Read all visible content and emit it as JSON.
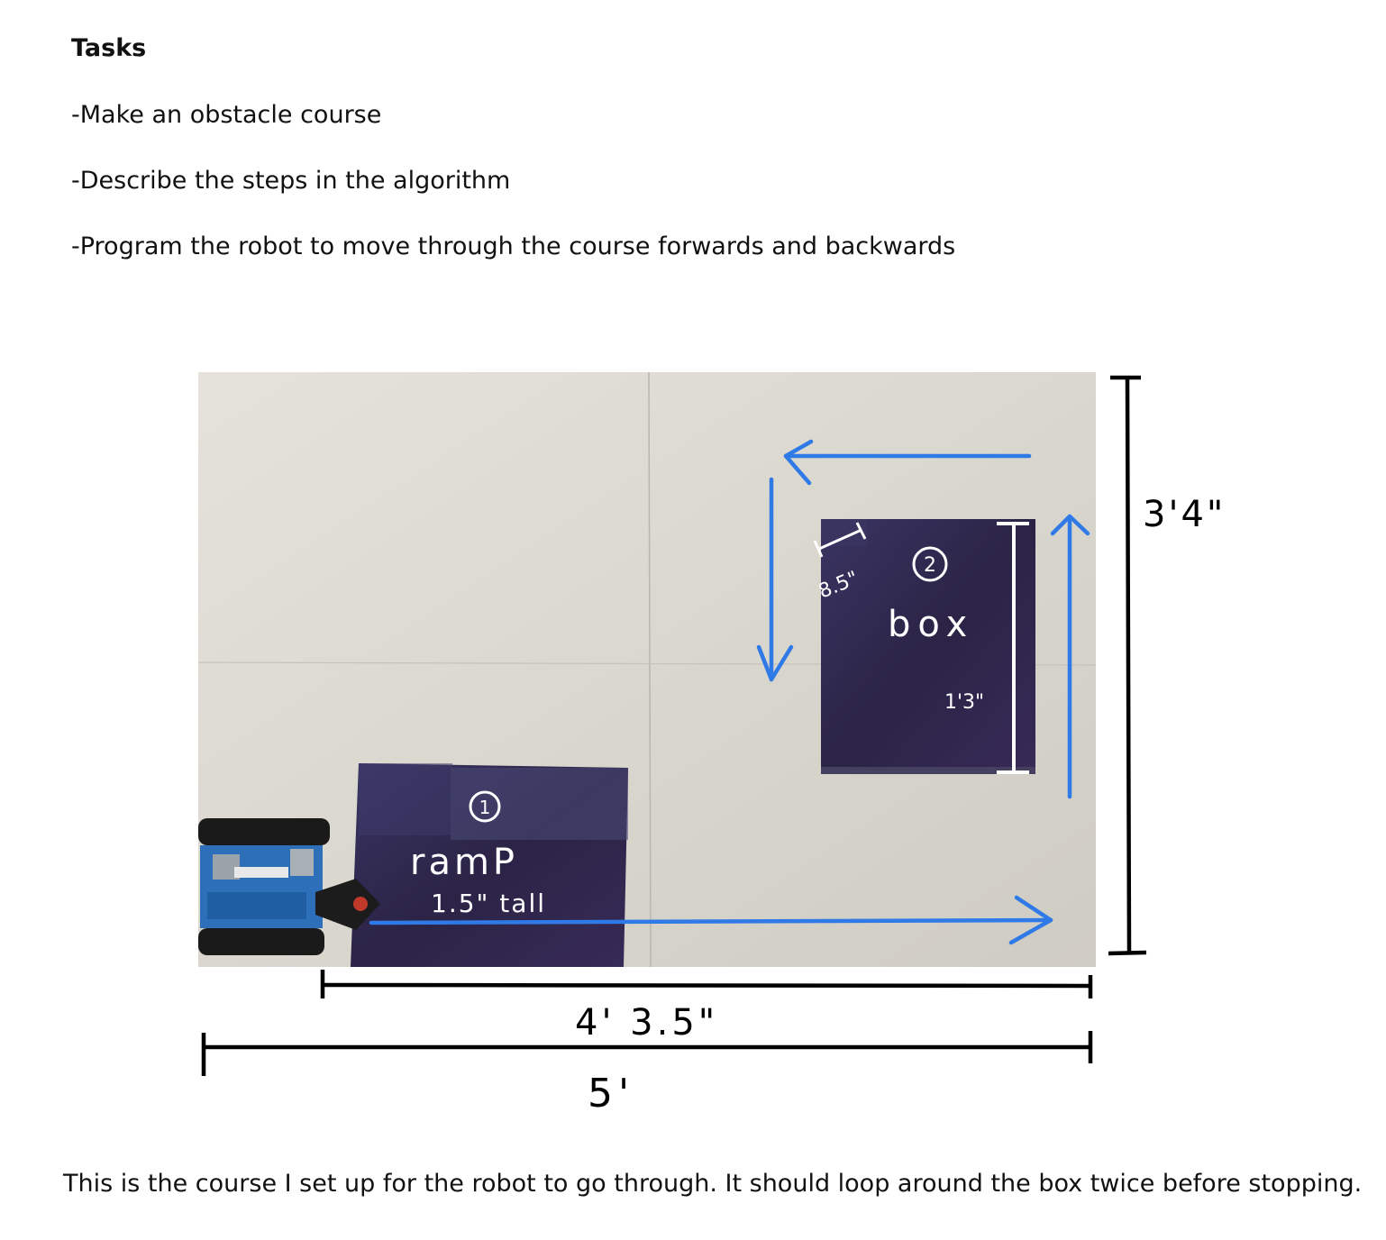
{
  "heading": "Tasks",
  "tasks": [
    "-Make an obstacle course",
    "-Describe the steps in the algorithm",
    "-Program the robot to move through the course forwards and backwards"
  ],
  "figure": {
    "ramp": {
      "number": "1",
      "label": "ramP",
      "height": "1.5\" tall"
    },
    "box": {
      "number": "2",
      "label": "box",
      "depth": "8.5\"",
      "length": "1'3\""
    },
    "dimensions": {
      "height": "3'4\"",
      "inner_width": "4' 3.5\"",
      "outer_width": "5'"
    },
    "colors": {
      "arrow": "#2f7ae6",
      "board": "#dcdad2",
      "obstacle": "#2c2445",
      "ink": "#000000"
    }
  },
  "caption": "This is the course I set up for the robot to go through. It should loop around the box twice before stopping."
}
